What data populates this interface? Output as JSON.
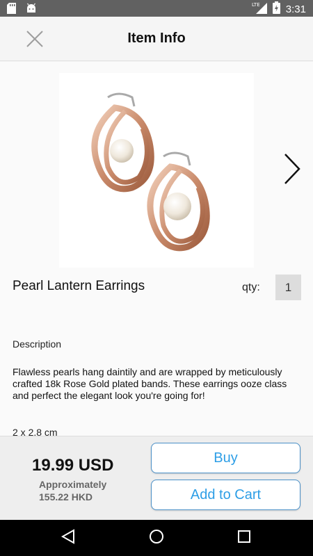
{
  "status_bar": {
    "time": "3:31",
    "network": "LTE",
    "icons": [
      "sd-card-icon",
      "android-icon",
      "signal-icon",
      "battery-icon"
    ]
  },
  "app_bar": {
    "title": "Item Info",
    "close_icon": "close-icon"
  },
  "product": {
    "name": "Pearl Lantern Earrings",
    "qty_label": "qty:",
    "qty_value": "1",
    "image_icon": "pearl-earrings-image",
    "next_icon": "chevron-right-icon"
  },
  "description": {
    "heading": "Description",
    "text": "Flawless pearls hang daintily and are wrapped by meticulously crafted 18k Rose Gold plated bands. These earrings ooze class and perfect the elegant look you're going for!",
    "size": "2 x 2.8 cm"
  },
  "footer": {
    "price": "19.99 USD",
    "approx_label": "Approximately",
    "approx_value": "155.22 HKD",
    "buy_label": "Buy",
    "cart_label": "Add to Cart",
    "accent_color": "#2d9ee6"
  },
  "nav_bar": {
    "icons": [
      "back-icon",
      "home-icon",
      "recents-icon"
    ]
  }
}
